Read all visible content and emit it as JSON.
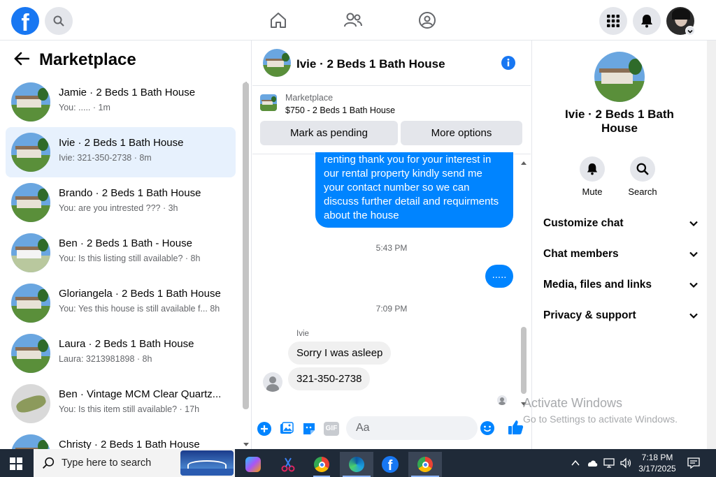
{
  "topnav": {
    "logo": "f",
    "icons": [
      "search-icon",
      "home-icon",
      "friends-icon",
      "groups-icon",
      "menu-grid-icon",
      "bell-icon",
      "avatar"
    ]
  },
  "left": {
    "title": "Marketplace",
    "conversations": [
      {
        "name": "Jamie · 2 Beds 1 Bath House",
        "sub": "You: ..... · 1m"
      },
      {
        "name": "Ivie · 2 Beds 1 Bath House",
        "sub": "Ivie: 321-350-2738 · 8m"
      },
      {
        "name": "Brando · 2 Beds 1 Bath House",
        "sub": "You: are you intrested ??? · 3h"
      },
      {
        "name": "Ben · 2 Beds 1 Bath - House",
        "sub": "You: Is this listing still available? · 8h"
      },
      {
        "name": "Gloriangela · 2 Beds 1 Bath House",
        "sub": "You: Yes this house is still available f...  8h"
      },
      {
        "name": "Laura · 2 Beds 1 Bath House",
        "sub": "Laura: 3213981898 · 8h"
      },
      {
        "name": "Ben · Vintage MCM Clear Quartz...",
        "sub": "You: Is this item still available? · 17h"
      },
      {
        "name": "Christy · 2 Beds 1 Bath House",
        "sub": ""
      }
    ]
  },
  "chat": {
    "title": "Ivie · 2 Beds 1 Bath House",
    "marketplace_label": "Marketplace",
    "listing": "$750 - 2 Beds 1 Bath House",
    "mark_pending": "Mark as pending",
    "more_options": "More options",
    "outgoing_message": "renting thank you for your interest in our rental property kindly send me your contact number so we can discuss further detail and requirments about the house",
    "ts1": "5:43 PM",
    "outgoing_short": ".....",
    "ts2": "7:09 PM",
    "sender": "Ivie",
    "incoming1": "Sorry I was asleep",
    "incoming2": "321-350-2738",
    "composer_placeholder": "Aa",
    "accent": "#0084ff"
  },
  "right": {
    "title": "Ivie · 2 Beds 1 Bath House",
    "mute_label": "Mute",
    "search_label": "Search",
    "rows": [
      "Customize chat",
      "Chat members",
      "Media, files and links",
      "Privacy & support"
    ]
  },
  "watermark": {
    "line1": "Activate Windows",
    "line2": "Go to Settings to activate Windows."
  },
  "taskbar": {
    "search_placeholder": "Type here to search",
    "time": "7:18 PM",
    "date": "3/17/2025"
  }
}
